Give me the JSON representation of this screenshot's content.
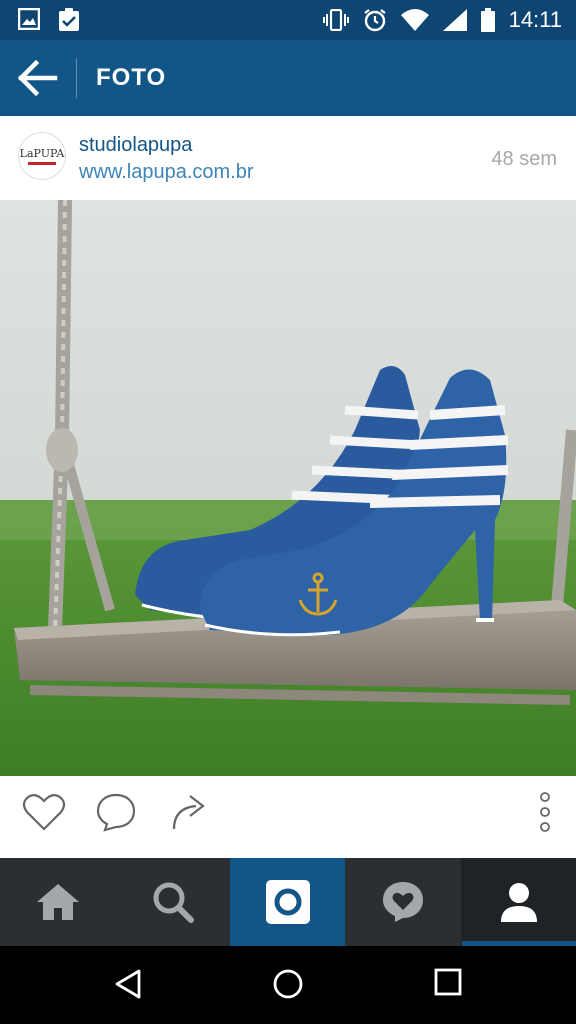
{
  "status_bar": {
    "time": "14:11",
    "left_icons": [
      "gallery-icon",
      "clipboard-check-icon"
    ],
    "right_icons": [
      "vibrate-icon",
      "alarm-icon",
      "wifi-icon",
      "signal-icon",
      "battery-icon"
    ]
  },
  "app_bar": {
    "title": "FOTO",
    "back_icon": "arrow-left-icon"
  },
  "post": {
    "avatar_text": "LaPUPA",
    "username": "studiolapupa",
    "website": "www.lapupa.com.br",
    "time_ago": "48 sem",
    "photo_description_icon": "photo"
  },
  "actions": {
    "icons": [
      "heart-icon",
      "comment-icon",
      "share-icon",
      "more-vertical-icon"
    ]
  },
  "bottom_nav": {
    "tabs": [
      "home-icon",
      "search-icon",
      "camera-icon",
      "activity-icon",
      "profile-icon"
    ],
    "active": "profile"
  },
  "system_nav": [
    "back-triangle-icon",
    "home-circle-icon",
    "recents-square-icon"
  ],
  "colors": {
    "status_bar": "#0e4572",
    "app_bar": "#125688",
    "username": "#125688",
    "link": "#3d84b8",
    "nav_bg": "#2b2f31"
  }
}
